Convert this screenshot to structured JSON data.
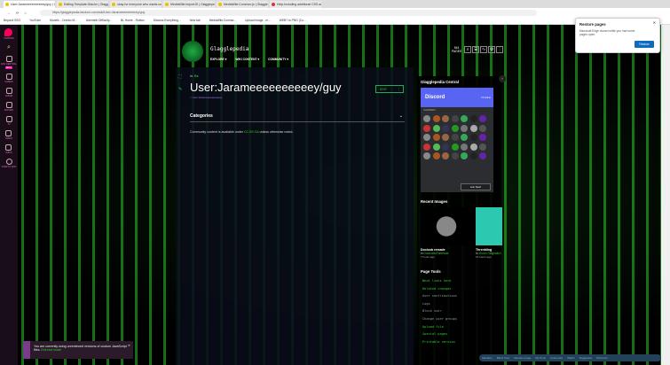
{
  "browser": {
    "tabs": [
      {
        "label": "User:Jarameeeeeeeeeey/guy | Gl",
        "active": true
      },
      {
        "label": "Editing Template:Glaclor | Glagg"
      },
      {
        "label": "okay for everyone who wants cu"
      },
      {
        "label": "MediaWiki:ImportJS | Glagglepe"
      },
      {
        "label": "MediaWiki:Common.js | Glagglep"
      },
      {
        "label": "Help:Including additional CSS an",
        "red": true
      }
    ],
    "url": "https://glagglepedia.fandom.com/wiki/User:Jarameeeeeeeeeey/guy",
    "bookmarks": [
      "Beyond SSO",
      "YouTube",
      "Models - Cerebo M...",
      "Artemeth Difficulty...",
      "BL Home - Roblox",
      "Discuss Everything...",
      "New tab",
      "MediaWiki:Commo...",
      "Upload image - ni...",
      "WEB? to PNG (Co..."
    ],
    "restore": {
      "title": "Restore pages",
      "text": "Microsoft Edge closed while you had some pages open.",
      "button": "Restore"
    }
  },
  "rail": [
    "FANDOM",
    "",
    "FAN CENTRAL",
    "GAMES",
    "ANIME",
    "MOVIES",
    "TV",
    "VIDEO",
    "WIKIS",
    "START A WIKI"
  ],
  "rail_badge": "BETA",
  "wiki": {
    "name": "Glagglepedia",
    "nav": [
      "EXPLORE ▾",
      "WIKI CONTENT ▾",
      "COMMUNITY ▾"
    ],
    "pages_count": "844",
    "pages_label": "PAGES"
  },
  "article": {
    "breadcrumb_prefix": "In:",
    "breadcrumb_link": "Gx",
    "title": "User:Jarameeeeeeeeeey/guy",
    "subtitle": "< User:Jarameeeeeeeeeey",
    "edit": "EDIT",
    "categories": "Categories",
    "license_pre": "Community content is available under ",
    "license_link": "CC-BY-SA",
    "license_post": " unless otherwise noted."
  },
  "sidebar": {
    "discord_title": "Glagglepedia Central",
    "discord_brand": "Discord",
    "discord_online": "73 Online",
    "members_label": "GLEMBERS",
    "join": "Join Now!",
    "recent_title": "Recent Images",
    "images": [
      {
        "caption": "Dooloob remade",
        "in": "In ",
        "where": "Dooloobs/Fanmade",
        "time": "7 hours ago"
      },
      {
        "caption": "Threnbling",
        "in": "In ",
        "where": "Zhoon Glagnatic/I",
        "time": "16 hours ago"
      }
    ],
    "tools_title": "Page Tools",
    "tools": [
      {
        "label": "What links here"
      },
      {
        "label": "Related changes"
      },
      {
        "label": "User contributions",
        "g": true
      },
      {
        "label": "Logs",
        "g": true
      },
      {
        "label": "Block user",
        "g": true
      },
      {
        "label": "Change user groups",
        "g": true
      },
      {
        "label": "Upload file"
      },
      {
        "label": "Special pages"
      },
      {
        "label": "Printable version"
      }
    ]
  },
  "toast": {
    "text": "You are currently using unreviewed versions of custom JavaScript files. ",
    "link": "Exit test mode"
  },
  "footer_bar": [
    "Sandbox",
    "Block User",
    "Random page",
    "My Tools",
    "Customize",
    "Watch",
    "Suggested",
    "Shortcuts"
  ]
}
